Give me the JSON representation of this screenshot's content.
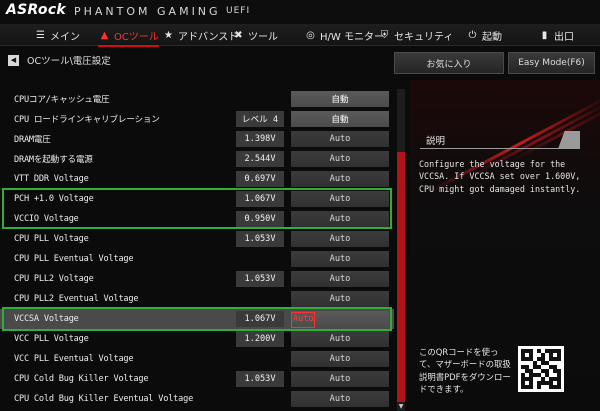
{
  "brand": {
    "logo": "ASRock",
    "subtitle": "PHANTOM GAMING",
    "uefi": "UEFI"
  },
  "nav": [
    {
      "label": "メイン",
      "icon": "main-menu-icon",
      "glyph": "☰",
      "active": false
    },
    {
      "label": "OCツール",
      "icon": "oc-tweaker-icon",
      "glyph": "▲",
      "active": true
    },
    {
      "label": "アドバンスド",
      "icon": "advanced-star-icon",
      "glyph": "★",
      "active": false
    },
    {
      "label": "ツール",
      "icon": "tool-icon",
      "glyph": "✖",
      "active": false
    },
    {
      "label": "H/W モニター",
      "icon": "hw-monitor-icon",
      "glyph": "◎",
      "active": false
    },
    {
      "label": "セキュリティ",
      "icon": "security-shield-icon",
      "glyph": "⛨",
      "active": false
    },
    {
      "label": "起動",
      "icon": "power-icon",
      "glyph": "⏻",
      "active": false
    },
    {
      "label": "出口",
      "icon": "exit-icon",
      "glyph": "▮",
      "active": false
    }
  ],
  "breadcrumb": {
    "text": "OCツール\\電圧設定"
  },
  "buttons": {
    "favorites": "お気に入り",
    "easy_mode": "Easy Mode(F6)"
  },
  "settings": [
    {
      "label": "CPUコア/キャッシュ電圧",
      "value": "",
      "option": "自動",
      "option_state": "active"
    },
    {
      "label": "CPU ロードラインキャリブレーション",
      "value": "レベル 4",
      "option": "自動",
      "option_state": "active"
    },
    {
      "label": "DRAM電圧",
      "value": "1.398V",
      "option": "Auto",
      "option_state": "normal"
    },
    {
      "label": "DRAMを起動する電源",
      "value": "2.544V",
      "option": "Auto",
      "option_state": "normal"
    },
    {
      "label": "VTT DDR Voltage",
      "value": "0.697V",
      "option": "Auto",
      "option_state": "normal"
    },
    {
      "label": "PCH +1.0 Voltage",
      "value": "1.067V",
      "option": "Auto",
      "option_state": "normal"
    },
    {
      "label": "VCCIO Voltage",
      "value": "0.950V",
      "option": "Auto",
      "option_state": "normal"
    },
    {
      "label": "CPU PLL Voltage",
      "value": "1.053V",
      "option": "Auto",
      "option_state": "normal"
    },
    {
      "label": "CPU PLL Eventual Voltage",
      "value": "",
      "option": "Auto",
      "option_state": "normal"
    },
    {
      "label": "CPU PLL2 Voltage",
      "value": "1.053V",
      "option": "Auto",
      "option_state": "normal"
    },
    {
      "label": "CPU PLL2 Eventual Voltage",
      "value": "",
      "option": "Auto",
      "option_state": "normal"
    },
    {
      "label": "VCCSA Voltage",
      "value": "1.067V",
      "option": "Auto",
      "option_state": "selected"
    },
    {
      "label": "VCC PLL Voltage",
      "value": "1.200V",
      "option": "Auto",
      "option_state": "normal"
    },
    {
      "label": "VCC PLL Eventual Voltage",
      "value": "",
      "option": "Auto",
      "option_state": "normal"
    },
    {
      "label": "CPU Cold Bug Killer Voltage",
      "value": "1.053V",
      "option": "Auto",
      "option_state": "normal"
    },
    {
      "label": "CPU Cold Bug Killer Eventual Voltage",
      "value": "",
      "option": "Auto",
      "option_state": "normal"
    }
  ],
  "description": {
    "title": "説明",
    "text": "Configure the voltage for the VCCSA. If VCCSA set over 1.600V, CPU might got damaged instantly.",
    "qr_text": "このQRコードを使って、マザーボードの取扱説明書PDFをダウンロードできます。"
  },
  "colors": {
    "accent": "#d01010",
    "highlight_box": "#2fae3a",
    "selected_row": "#4a4a4a"
  }
}
